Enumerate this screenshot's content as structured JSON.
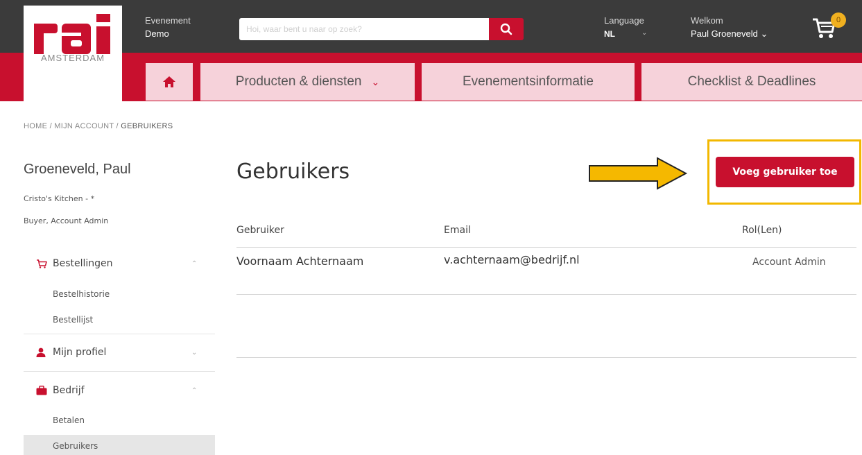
{
  "header": {
    "logo_text": "rai",
    "logo_subtext": "AMSTERDAM",
    "event_label": "Evenement",
    "event_value": "Demo",
    "search_placeholder": "Hoi, waar bent u naar op zoek?",
    "language_label": "Language",
    "language_value": "NL",
    "welcome_label": "Welkom",
    "welcome_user": "Paul Groeneveld",
    "cart_count": "0"
  },
  "nav": {
    "tabs": [
      {
        "label": ""
      },
      {
        "label": "Producten & diensten"
      },
      {
        "label": "Evenementsinformatie"
      },
      {
        "label": "Checklist & Deadlines"
      }
    ]
  },
  "breadcrumb": {
    "items": [
      "HOME",
      "MIJN ACCOUNT",
      "GEBRUIKERS"
    ],
    "separator": "/"
  },
  "sidebar": {
    "name": "Groeneveld, Paul",
    "company": "Cristo's Kitchen - *",
    "roles": "Buyer, Account Admin",
    "sections": [
      {
        "label": "Bestellingen",
        "icon": "cart-icon",
        "items": [
          "Bestelhistorie",
          "Bestellijst"
        ]
      },
      {
        "label": "Mijn profiel",
        "icon": "user-icon",
        "items": []
      },
      {
        "label": "Bedrijf",
        "icon": "briefcase-icon",
        "items": [
          "Betalen",
          "Gebruikers"
        ]
      }
    ]
  },
  "main": {
    "title": "Gebruikers",
    "add_button": "Voeg gebruiker toe",
    "columns": [
      "Gebruiker",
      "Email",
      "Rol(Len)"
    ],
    "rows": [
      {
        "user": "Voornaam Achternaam",
        "email": "v.achternaam@bedrijf.nl",
        "role": "Account Admin"
      }
    ]
  },
  "colors": {
    "brand_red": "#c8102e",
    "tab_pink": "#f6d2da",
    "topbar": "#3b3b3b",
    "highlight": "#f2b800"
  }
}
